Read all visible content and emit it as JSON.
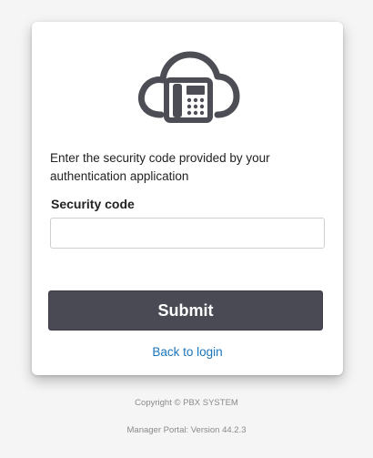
{
  "icons": {
    "logo": "cloud-phone-icon"
  },
  "colors": {
    "submit_bg": "#4a4a55",
    "link": "#1a75bc",
    "icon": "#4d4d55"
  },
  "form": {
    "prompt": "Enter the security code provided by your authentication application",
    "label": "Security code",
    "value": "",
    "submit_label": "Submit",
    "back_label": "Back to login"
  },
  "footer": {
    "copyright": "Copyright © PBX SYSTEM",
    "version": "Manager Portal: Version 44.2.3"
  }
}
